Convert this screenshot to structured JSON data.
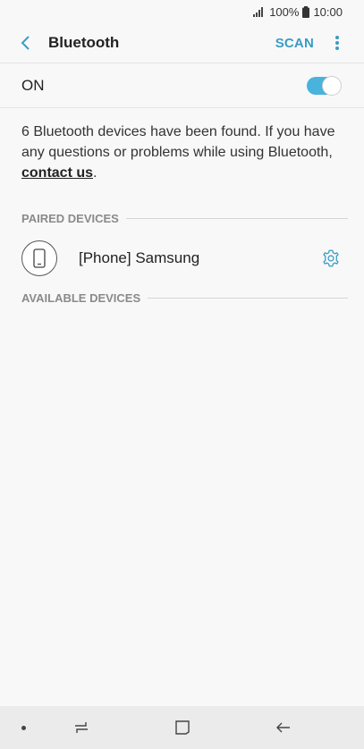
{
  "status": {
    "battery_percent": "100%",
    "time": "10:00"
  },
  "header": {
    "title": "Bluetooth",
    "scan_label": "SCAN"
  },
  "bluetooth": {
    "state_label": "ON",
    "enabled": true,
    "toggle_color": "#48b3dc"
  },
  "info": {
    "text": "6 Bluetooth devices have been found. If you have any questions or problems while using Bluetooth, ",
    "link": "contact us",
    "suffix": "."
  },
  "paired": {
    "header": "PAIRED DEVICES",
    "devices": [
      {
        "name": "[Phone] Samsung",
        "icon": "phone-icon"
      }
    ]
  },
  "available": {
    "header": "AVAILABLE DEVICES"
  },
  "colors": {
    "accent": "#3b9cc2",
    "background": "#f8f8f8"
  }
}
